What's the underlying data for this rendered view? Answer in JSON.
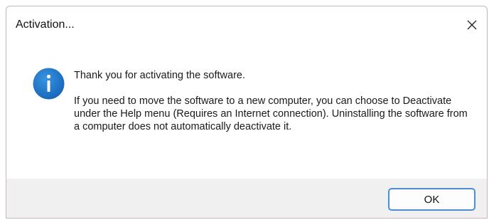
{
  "window": {
    "title": "Activation..."
  },
  "icons": {
    "close": "close-icon",
    "info": "info-icon"
  },
  "message": {
    "line1": "Thank you for activating the software.",
    "paragraph2": "If you need to move the software to a new computer, you can choose to Deactivate under the Help menu (Requires an Internet connection). Uninstalling the software from a computer does not automatically deactivate it."
  },
  "buttons": {
    "ok_label": "OK"
  },
  "colors": {
    "info_icon_blue": "#1e78c8",
    "button_focus_border": "#4a8fd6",
    "footer_background": "#f0f0f0"
  }
}
